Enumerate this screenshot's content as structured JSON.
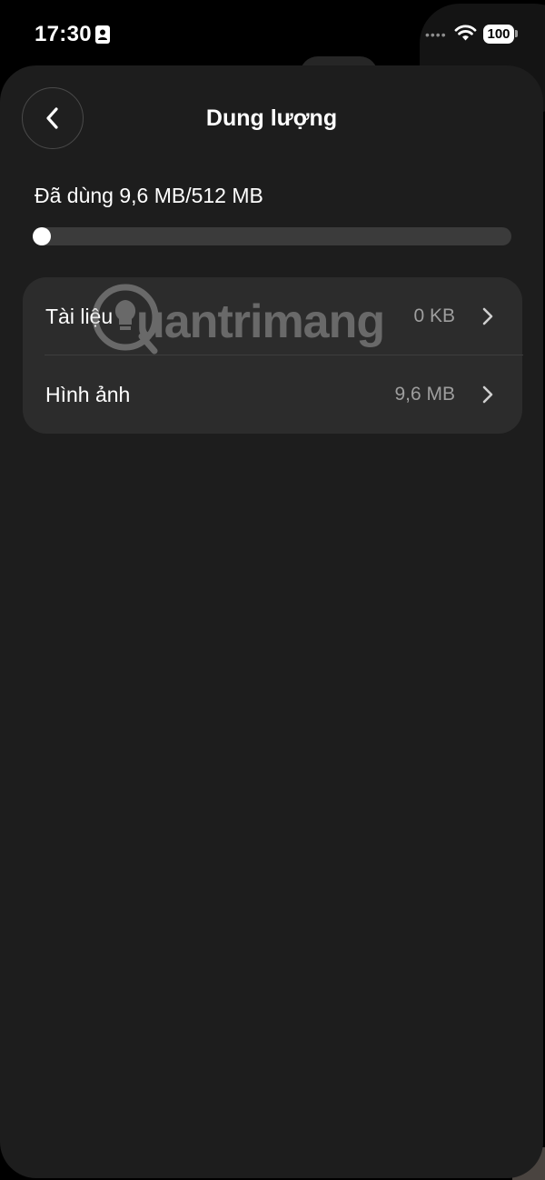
{
  "status_bar": {
    "time": "17:30",
    "battery": "100",
    "person_icon": "person-badge-icon",
    "wifi_icon": "wifi-icon"
  },
  "header": {
    "title": "Dung lượng",
    "back_icon": "chevron-left-icon"
  },
  "storage": {
    "used_label": "Đã dùng 9,6 MB/512 MB",
    "used_fraction": 0.019
  },
  "items": [
    {
      "label": "Tài liệu",
      "value": "0 KB",
      "icon": "chevron-right-icon"
    },
    {
      "label": "Hình ảnh",
      "value": "9,6 MB",
      "icon": "chevron-right-icon"
    }
  ],
  "watermark": {
    "text": "uantrimang"
  },
  "colors": {
    "background": "#000000",
    "sheet": "#1d1d1d",
    "card": "#2c2c2c",
    "track": "#3b3b3b",
    "accent": "#ffffff",
    "secondary_text": "#9e9e9e"
  }
}
